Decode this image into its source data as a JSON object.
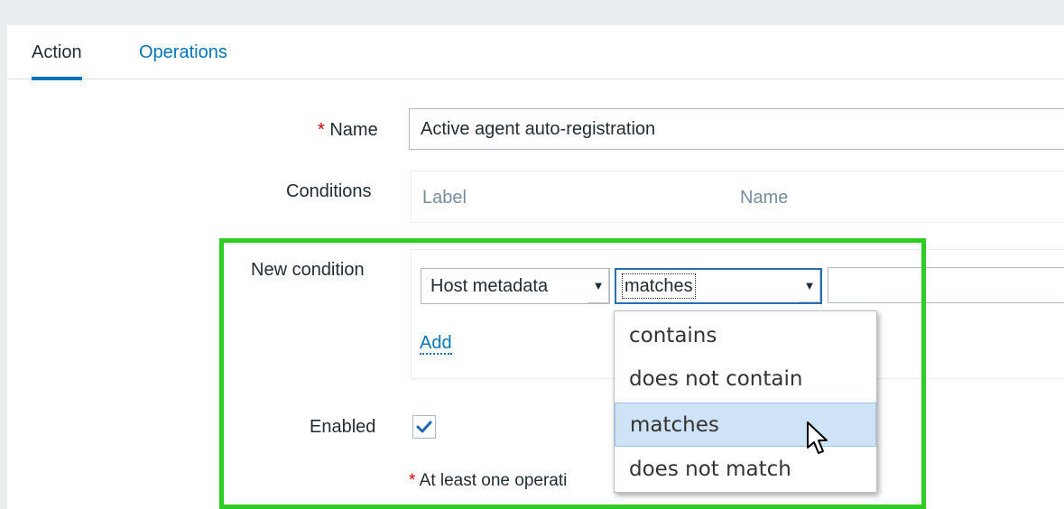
{
  "tabs": [
    {
      "label": "Action",
      "active": true
    },
    {
      "label": "Operations",
      "active": false
    }
  ],
  "form": {
    "name": {
      "required_mark": "*",
      "label": "Name",
      "value": "Active agent auto-registration"
    },
    "conditions": {
      "label": "Conditions",
      "columns": [
        "Label",
        "Name"
      ]
    },
    "new_condition": {
      "label": "New condition",
      "type_select": "Host metadata",
      "operator_select": "matches",
      "value": "",
      "add_label": "Add"
    },
    "enabled": {
      "label": "Enabled",
      "checked": true
    },
    "note": {
      "required_mark": "*",
      "text": "At least one operati"
    }
  },
  "dropdown": {
    "options": [
      "contains",
      "does not contain",
      "matches",
      "does not match"
    ],
    "highlighted": "matches"
  },
  "colors": {
    "accent": "#0275b8",
    "highlight_frame": "#2ecc24",
    "required": "#d40000"
  }
}
